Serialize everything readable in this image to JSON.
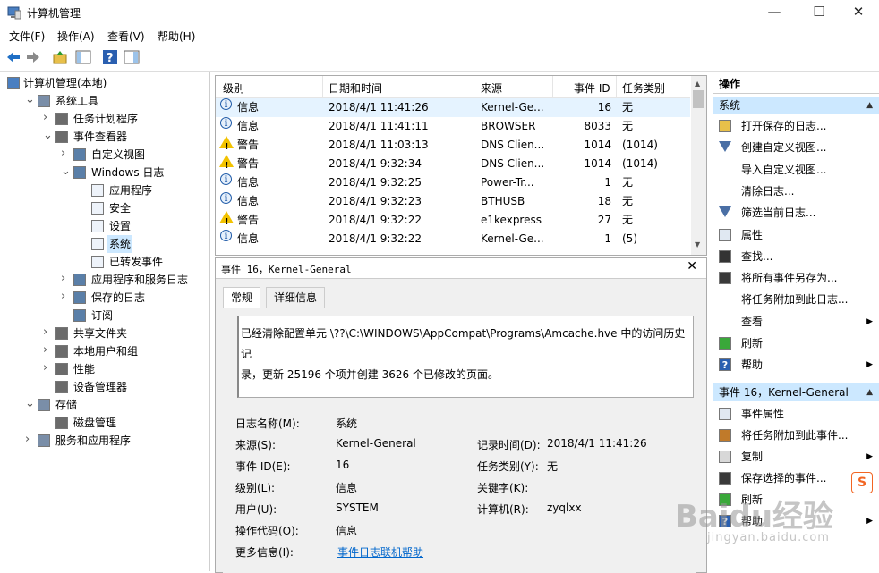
{
  "window": {
    "title": "计算机管理",
    "controls": [
      "—",
      "☐",
      "✕"
    ]
  },
  "menu": [
    "文件(F)",
    "操作(A)",
    "查看(V)",
    "帮助(H)"
  ],
  "tree": [
    {
      "label": "计算机管理(本地)",
      "level": 0,
      "exp": ""
    },
    {
      "label": "系统工具",
      "level": 1,
      "exp": "v"
    },
    {
      "label": "任务计划程序",
      "level": 2,
      "exp": ">"
    },
    {
      "label": "事件查看器",
      "level": 2,
      "exp": "v"
    },
    {
      "label": "自定义视图",
      "level": 3,
      "exp": ">"
    },
    {
      "label": "Windows 日志",
      "level": 3,
      "exp": "v"
    },
    {
      "label": "应用程序",
      "level": 4,
      "exp": ""
    },
    {
      "label": "安全",
      "level": 4,
      "exp": ""
    },
    {
      "label": "设置",
      "level": 4,
      "exp": ""
    },
    {
      "label": "系统",
      "level": 4,
      "exp": "",
      "selected": true
    },
    {
      "label": "已转发事件",
      "level": 4,
      "exp": ""
    },
    {
      "label": "应用程序和服务日志",
      "level": 3,
      "exp": ">"
    },
    {
      "label": "保存的日志",
      "level": 3,
      "exp": ">"
    },
    {
      "label": "订阅",
      "level": 3,
      "exp": ""
    },
    {
      "label": "共享文件夹",
      "level": 2,
      "exp": ">"
    },
    {
      "label": "本地用户和组",
      "level": 2,
      "exp": ">"
    },
    {
      "label": "性能",
      "level": 2,
      "exp": ">"
    },
    {
      "label": "设备管理器",
      "level": 2,
      "exp": ""
    },
    {
      "label": "存储",
      "level": 1,
      "exp": "v"
    },
    {
      "label": "磁盘管理",
      "level": 2,
      "exp": ""
    },
    {
      "label": "服务和应用程序",
      "level": 1,
      "exp": ">"
    }
  ],
  "list": {
    "columns": [
      "级别",
      "日期和时间",
      "来源",
      "事件 ID",
      "任务类别"
    ],
    "rows": [
      {
        "level": "信息",
        "type": "info",
        "datetime": "2018/4/1 11:41:26",
        "source": "Kernel-Ge...",
        "id": "16",
        "task": "无"
      },
      {
        "level": "信息",
        "type": "info",
        "datetime": "2018/4/1 11:41:11",
        "source": "BROWSER",
        "id": "8033",
        "task": "无"
      },
      {
        "level": "警告",
        "type": "warn",
        "datetime": "2018/4/1 11:03:13",
        "source": "DNS Clien...",
        "id": "1014",
        "task": "(1014)"
      },
      {
        "level": "警告",
        "type": "warn",
        "datetime": "2018/4/1 9:32:34",
        "source": "DNS Clien...",
        "id": "1014",
        "task": "(1014)"
      },
      {
        "level": "信息",
        "type": "info",
        "datetime": "2018/4/1 9:32:25",
        "source": "Power-Tr...",
        "id": "1",
        "task": "无"
      },
      {
        "level": "信息",
        "type": "info",
        "datetime": "2018/4/1 9:32:23",
        "source": "BTHUSB",
        "id": "18",
        "task": "无"
      },
      {
        "level": "警告",
        "type": "warn",
        "datetime": "2018/4/1 9:32:22",
        "source": "e1kexpress",
        "id": "27",
        "task": "无"
      },
      {
        "level": "信息",
        "type": "info",
        "datetime": "2018/4/1 9:32:22",
        "source": "Kernel-Ge...",
        "id": "1",
        "task": "(5)"
      }
    ]
  },
  "detail": {
    "title": "事件 16，Kernel-General",
    "tabs": [
      "常规",
      "详细信息"
    ],
    "message_line1": "已经清除配置单元 \\??\\C:\\WINDOWS\\AppCompat\\Programs\\Amcache.hve 中的访问历史记",
    "message_line2": "录，更新 25196 个项并创建 3626 个已修改的页面。",
    "fields": {
      "log_name_label": "日志名称(M):",
      "log_name": "系统",
      "source_label": "来源(S):",
      "source": "Kernel-General",
      "logged_label": "记录时间(D):",
      "logged": "2018/4/1 11:41:26",
      "event_id_label": "事件 ID(E):",
      "event_id": "16",
      "task_label": "任务类别(Y):",
      "task": "无",
      "level_label": "级别(L):",
      "level": "信息",
      "keywords_label": "关键字(K):",
      "keywords": "",
      "user_label": "用户(U):",
      "user": "SYSTEM",
      "computer_label": "计算机(R):",
      "computer": "zyqlxx",
      "opcode_label": "操作代码(O):",
      "opcode": "信息",
      "more_label": "更多信息(I):",
      "more_link": "事件日志联机帮助"
    }
  },
  "actions": {
    "header": "操作",
    "section1": "系统",
    "items1": [
      {
        "label": "打开保存的日志...",
        "icon": "folder-icon"
      },
      {
        "label": "创建自定义视图...",
        "icon": "filter-icon"
      },
      {
        "label": "导入自定义视图...",
        "icon": ""
      },
      {
        "label": "清除日志...",
        "icon": ""
      },
      {
        "label": "筛选当前日志...",
        "icon": "filter-icon"
      },
      {
        "label": "属性",
        "icon": "properties-icon"
      },
      {
        "label": "查找...",
        "icon": "binoculars-icon"
      },
      {
        "label": "将所有事件另存为...",
        "icon": "save-icon"
      },
      {
        "label": "将任务附加到此日志...",
        "icon": ""
      },
      {
        "label": "查看",
        "icon": "",
        "arrow": true
      },
      {
        "label": "刷新",
        "icon": "refresh-icon"
      },
      {
        "label": "帮助",
        "icon": "help-icon",
        "arrow": true
      }
    ],
    "section2": "事件 16，Kernel-General",
    "items2": [
      {
        "label": "事件属性",
        "icon": "properties-icon"
      },
      {
        "label": "将任务附加到此事件...",
        "icon": "task-icon"
      },
      {
        "label": "复制",
        "icon": "copy-icon",
        "arrow": true
      },
      {
        "label": "保存选择的事件...",
        "icon": "save-icon"
      },
      {
        "label": "刷新",
        "icon": "refresh-icon"
      },
      {
        "label": "帮助",
        "icon": "help-icon",
        "arrow": true
      }
    ]
  },
  "watermark": {
    "main": "Baidu经验",
    "sub": "jingyan.baidu.com",
    "badge": "S"
  }
}
